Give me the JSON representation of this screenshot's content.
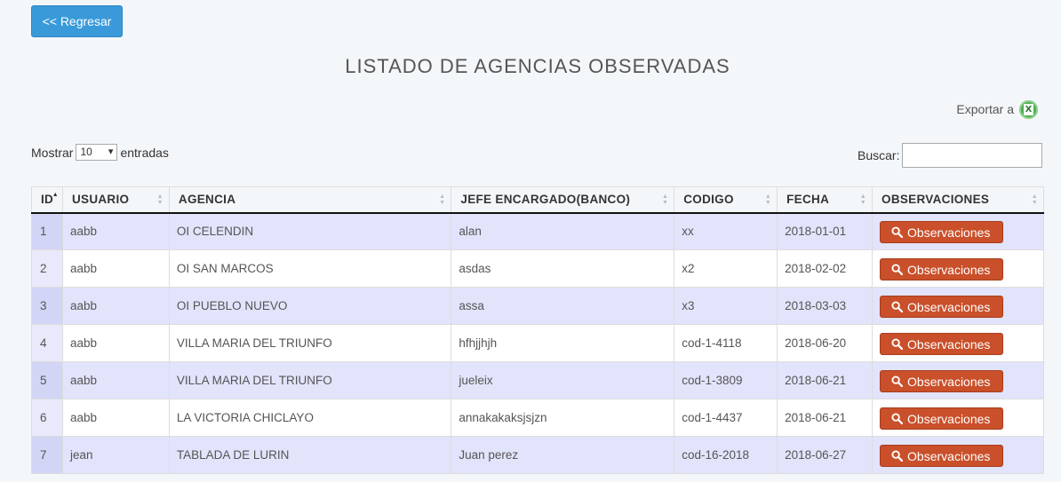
{
  "nav": {
    "back_label": "<< Regresar"
  },
  "page": {
    "title": "LISTADO DE AGENCIAS OBSERVADAS"
  },
  "export": {
    "label": "Exportar a",
    "icon": "excel-icon"
  },
  "controls": {
    "show_prefix": "Mostrar",
    "show_value": "10",
    "show_suffix": "entradas",
    "search_label": "Buscar:",
    "search_value": ""
  },
  "table": {
    "headers": [
      "ID",
      "USUARIO",
      "AGENCIA",
      "JEFE ENCARGADO(BANCO)",
      "CODIGO",
      "FECHA",
      "OBSERVACIONES"
    ],
    "action_label": "Observaciones",
    "rows": [
      {
        "id": "1",
        "usuario": "aabb",
        "agencia": "OI CELENDIN",
        "jefe": "alan",
        "codigo": "xx",
        "fecha": "2018-01-01"
      },
      {
        "id": "2",
        "usuario": "aabb",
        "agencia": "OI SAN MARCOS",
        "jefe": "asdas",
        "codigo": "x2",
        "fecha": "2018-02-02"
      },
      {
        "id": "3",
        "usuario": "aabb",
        "agencia": "OI PUEBLO NUEVO",
        "jefe": "assa",
        "codigo": "x3",
        "fecha": "2018-03-03"
      },
      {
        "id": "4",
        "usuario": "aabb",
        "agencia": "VILLA MARIA DEL TRIUNFO",
        "jefe": "hfhjjhjh",
        "codigo": "cod-1-4118",
        "fecha": "2018-06-20"
      },
      {
        "id": "5",
        "usuario": "aabb",
        "agencia": "VILLA MARIA DEL TRIUNFO",
        "jefe": "jueleix",
        "codigo": "cod-1-3809",
        "fecha": "2018-06-21"
      },
      {
        "id": "6",
        "usuario": "aabb",
        "agencia": "LA VICTORIA CHICLAYO",
        "jefe": "annakakaksjsjzn",
        "codigo": "cod-1-4437",
        "fecha": "2018-06-21"
      },
      {
        "id": "7",
        "usuario": "jean",
        "agencia": "TABLADA DE LURIN",
        "jefe": "Juan perez",
        "codigo": "cod-16-2018",
        "fecha": "2018-06-27"
      }
    ]
  },
  "colors": {
    "primary": "#3a9ad9",
    "danger": "#c9502a",
    "row_striped": "#e2e4fb"
  }
}
